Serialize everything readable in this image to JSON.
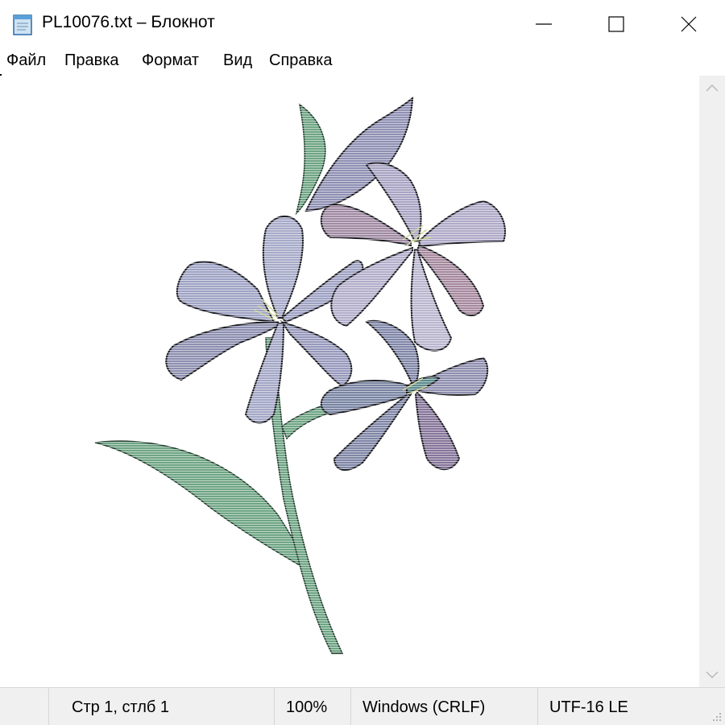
{
  "window": {
    "title": "PL10076.txt – Блокнот",
    "app_icon": "notepad-icon",
    "controls": {
      "minimize": "minimize-icon",
      "maximize": "maximize-icon",
      "close": "close-icon"
    }
  },
  "menu": {
    "items": [
      {
        "label": "Файл"
      },
      {
        "label": "Правка"
      },
      {
        "label": "Формат"
      },
      {
        "label": "Вид"
      },
      {
        "label": "Справка"
      }
    ]
  },
  "document": {
    "content_description_icon": "ascii-art-lily-flowers",
    "colors": {
      "petal": "#a7aac8",
      "petal_dark": "#6b6a86",
      "pink_petal": "#a9899e",
      "teal": "#5d8a8e",
      "stem": "#6fa584",
      "outline": "#1b1b22"
    }
  },
  "scrollbar": {
    "up_icon": "scroll-up-arrow-icon",
    "down_icon": "scroll-down-arrow-icon"
  },
  "status": {
    "position": "Стр 1, стлб 1",
    "zoom": "100%",
    "line_endings": "Windows (CRLF)",
    "encoding": "UTF-16 LE"
  }
}
